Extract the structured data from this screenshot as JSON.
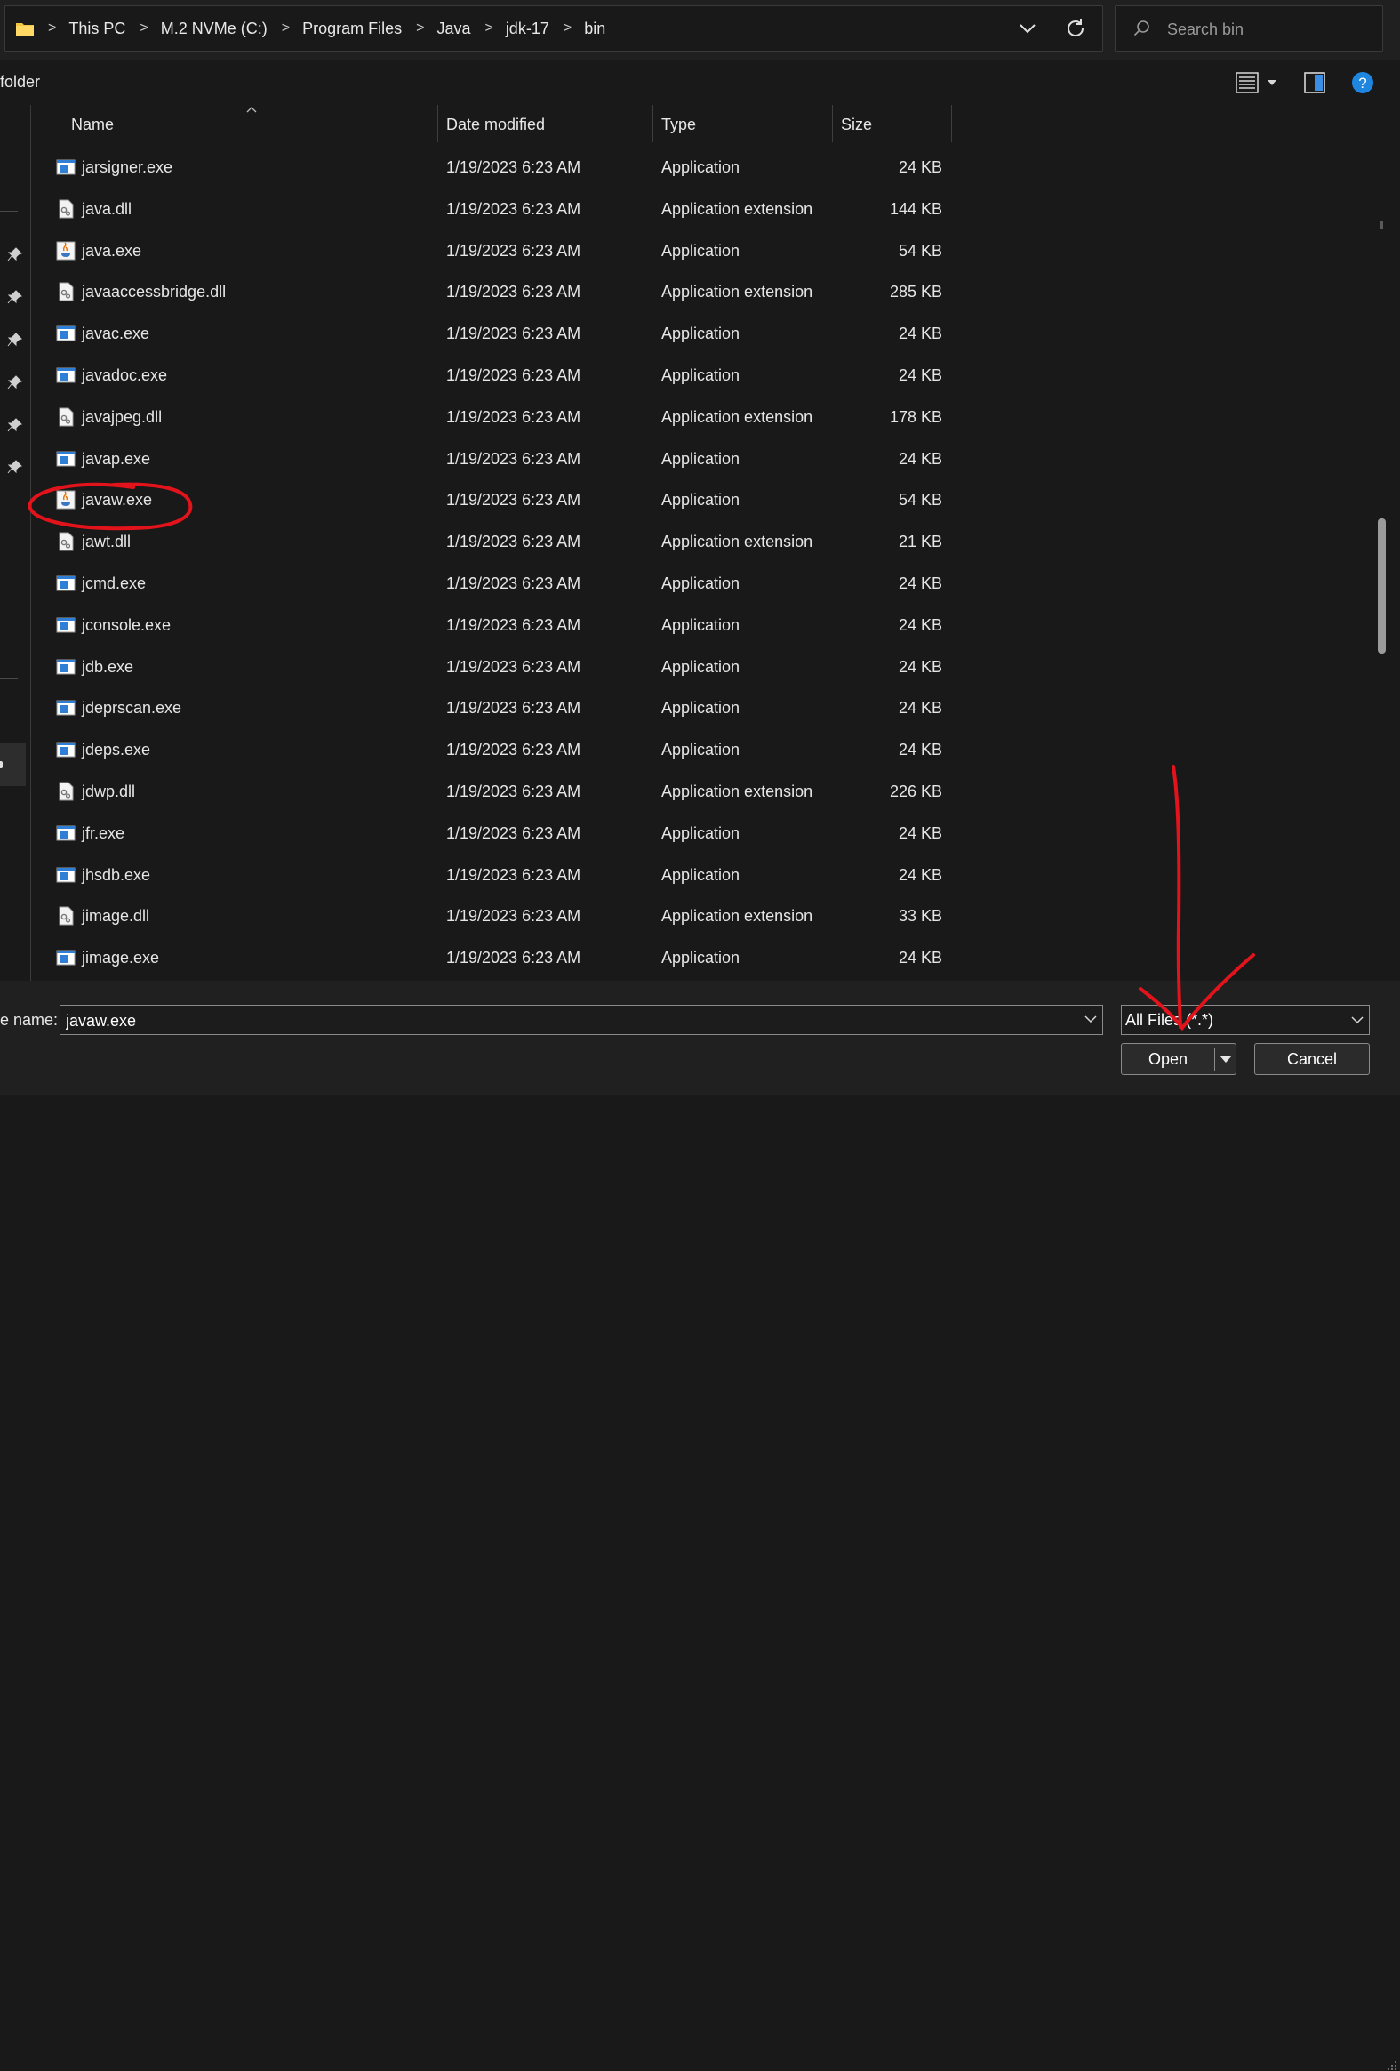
{
  "address": {
    "breadcrumbs": [
      "This PC",
      "M.2 NVMe (C:)",
      "Program Files",
      "Java",
      "jdk-17",
      "bin"
    ]
  },
  "search": {
    "placeholder": "Search bin"
  },
  "commandbar": {
    "new_folder_label": "folder"
  },
  "columns": {
    "name": "Name",
    "date": "Date modified",
    "type": "Type",
    "size": "Size"
  },
  "files": [
    {
      "name": "jarsigner.exe",
      "date": "1/19/2023 6:23 AM",
      "type": "Application",
      "size": "24 KB",
      "icon": "exe-icon"
    },
    {
      "name": "java.dll",
      "date": "1/19/2023 6:23 AM",
      "type": "Application extension",
      "size": "144 KB",
      "icon": "dll-icon"
    },
    {
      "name": "java.exe",
      "date": "1/19/2023 6:23 AM",
      "type": "Application",
      "size": "54 KB",
      "icon": "java-icon"
    },
    {
      "name": "javaaccessbridge.dll",
      "date": "1/19/2023 6:23 AM",
      "type": "Application extension",
      "size": "285 KB",
      "icon": "dll-icon"
    },
    {
      "name": "javac.exe",
      "date": "1/19/2023 6:23 AM",
      "type": "Application",
      "size": "24 KB",
      "icon": "exe-icon"
    },
    {
      "name": "javadoc.exe",
      "date": "1/19/2023 6:23 AM",
      "type": "Application",
      "size": "24 KB",
      "icon": "exe-icon"
    },
    {
      "name": "javajpeg.dll",
      "date": "1/19/2023 6:23 AM",
      "type": "Application extension",
      "size": "178 KB",
      "icon": "dll-icon"
    },
    {
      "name": "javap.exe",
      "date": "1/19/2023 6:23 AM",
      "type": "Application",
      "size": "24 KB",
      "icon": "exe-icon"
    },
    {
      "name": "javaw.exe",
      "date": "1/19/2023 6:23 AM",
      "type": "Application",
      "size": "54 KB",
      "icon": "java-icon"
    },
    {
      "name": "jawt.dll",
      "date": "1/19/2023 6:23 AM",
      "type": "Application extension",
      "size": "21 KB",
      "icon": "dll-icon"
    },
    {
      "name": "jcmd.exe",
      "date": "1/19/2023 6:23 AM",
      "type": "Application",
      "size": "24 KB",
      "icon": "exe-icon"
    },
    {
      "name": "jconsole.exe",
      "date": "1/19/2023 6:23 AM",
      "type": "Application",
      "size": "24 KB",
      "icon": "exe-icon"
    },
    {
      "name": "jdb.exe",
      "date": "1/19/2023 6:23 AM",
      "type": "Application",
      "size": "24 KB",
      "icon": "exe-icon"
    },
    {
      "name": "jdeprscan.exe",
      "date": "1/19/2023 6:23 AM",
      "type": "Application",
      "size": "24 KB",
      "icon": "exe-icon"
    },
    {
      "name": "jdeps.exe",
      "date": "1/19/2023 6:23 AM",
      "type": "Application",
      "size": "24 KB",
      "icon": "exe-icon"
    },
    {
      "name": "jdwp.dll",
      "date": "1/19/2023 6:23 AM",
      "type": "Application extension",
      "size": "226 KB",
      "icon": "dll-icon"
    },
    {
      "name": "jfr.exe",
      "date": "1/19/2023 6:23 AM",
      "type": "Application",
      "size": "24 KB",
      "icon": "exe-icon"
    },
    {
      "name": "jhsdb.exe",
      "date": "1/19/2023 6:23 AM",
      "type": "Application",
      "size": "24 KB",
      "icon": "exe-icon"
    },
    {
      "name": "jimage.dll",
      "date": "1/19/2023 6:23 AM",
      "type": "Application extension",
      "size": "33 KB",
      "icon": "dll-icon"
    },
    {
      "name": "jimage.exe",
      "date": "1/19/2023 6:23 AM",
      "type": "Application",
      "size": "24 KB",
      "icon": "exe-icon"
    }
  ],
  "bottom": {
    "file_name_label": "e name:",
    "file_name_value": "javaw.exe",
    "filter_value": "All Files (*.*)",
    "open_label": "Open",
    "cancel_label": "Cancel"
  },
  "colors": {
    "background": "#191919",
    "toolbar": "#202020",
    "text": "#e6e6e6",
    "folder": "#f4c542",
    "exe_blue": "#2f7fd6",
    "help_blue": "#1f86e0",
    "annotation_red": "#e3131b"
  },
  "annotations": [
    {
      "type": "circle",
      "label": "javaw.exe highlight"
    },
    {
      "type": "arrow",
      "label": "points to file type filter"
    }
  ]
}
